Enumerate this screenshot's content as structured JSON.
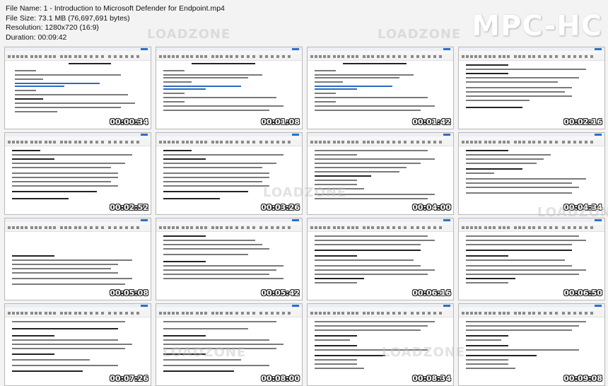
{
  "header": {
    "file_name": "File Name: 1 - Introduction to Microsoft Defender for Endpoint.mp4",
    "file_size": "File Size: 73.1 MB (76,697,691 bytes)",
    "resolution": "Resolution: 1280x720 (16:9)",
    "duration": "Duration: 00:09:42"
  },
  "logo": "MPC-HC",
  "watermark": "LOADZONE",
  "thumbnails": [
    {
      "timestamp": "00:00:34"
    },
    {
      "timestamp": "00:01:08"
    },
    {
      "timestamp": "00:01:42"
    },
    {
      "timestamp": "00:02:16"
    },
    {
      "timestamp": "00:02:52"
    },
    {
      "timestamp": "00:03:26"
    },
    {
      "timestamp": "00:04:00"
    },
    {
      "timestamp": "00:04:34"
    },
    {
      "timestamp": "00:05:08"
    },
    {
      "timestamp": "00:05:42"
    },
    {
      "timestamp": "00:06:16"
    },
    {
      "timestamp": "00:06:50"
    },
    {
      "timestamp": "00:07:26"
    },
    {
      "timestamp": "00:08:00"
    },
    {
      "timestamp": "00:08:34"
    },
    {
      "timestamp": "00:09:08"
    }
  ]
}
